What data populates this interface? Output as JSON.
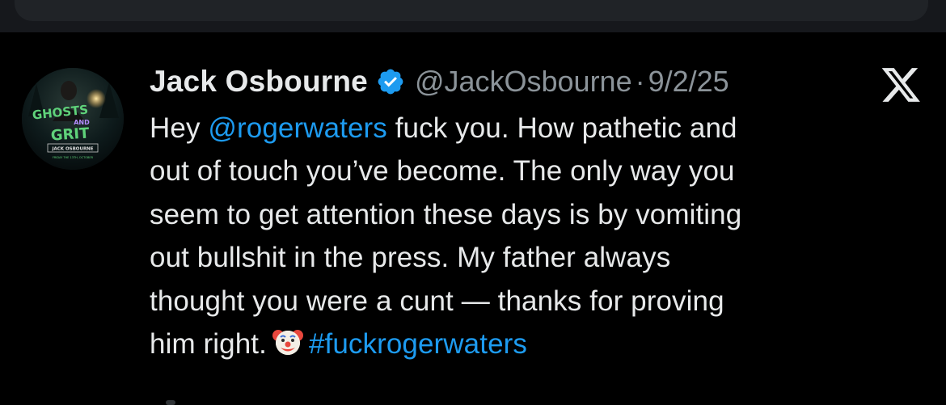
{
  "colors": {
    "background": "#000000",
    "text": "#e7e9ea",
    "secondary_text": "#8b9399",
    "link": "#1d9bf0",
    "verified_badge": "#1d9bf0"
  },
  "tweet": {
    "author": {
      "display_name": "Jack Osbourne",
      "handle": "@JackOsbourne",
      "verified": true,
      "avatar_text": {
        "title_1": "GHOSTS",
        "title_2": "AND",
        "title_3": "GRIT",
        "name": "JACK OSBOURNE",
        "tagline": "FRIDAY THE 13TH, OCTOBER"
      }
    },
    "separator": "·",
    "date": "9/2/25",
    "platform_icon": "x-logo-icon",
    "body": {
      "line1_pre": "Hey ",
      "mention": "@rogerwaters",
      "line1_post": " fuck you. How pathetic and",
      "line2": "out of touch you’ve become. The only way you",
      "line3": "seem to get attention these days is by vomiting",
      "line4": "out bullshit in the press. My father always",
      "line5": "thought you were a cunt — thanks for proving",
      "line6_pre": "him right.",
      "emoji": "clown-face-icon",
      "hashtag": "#fuckrogerwaters"
    }
  }
}
